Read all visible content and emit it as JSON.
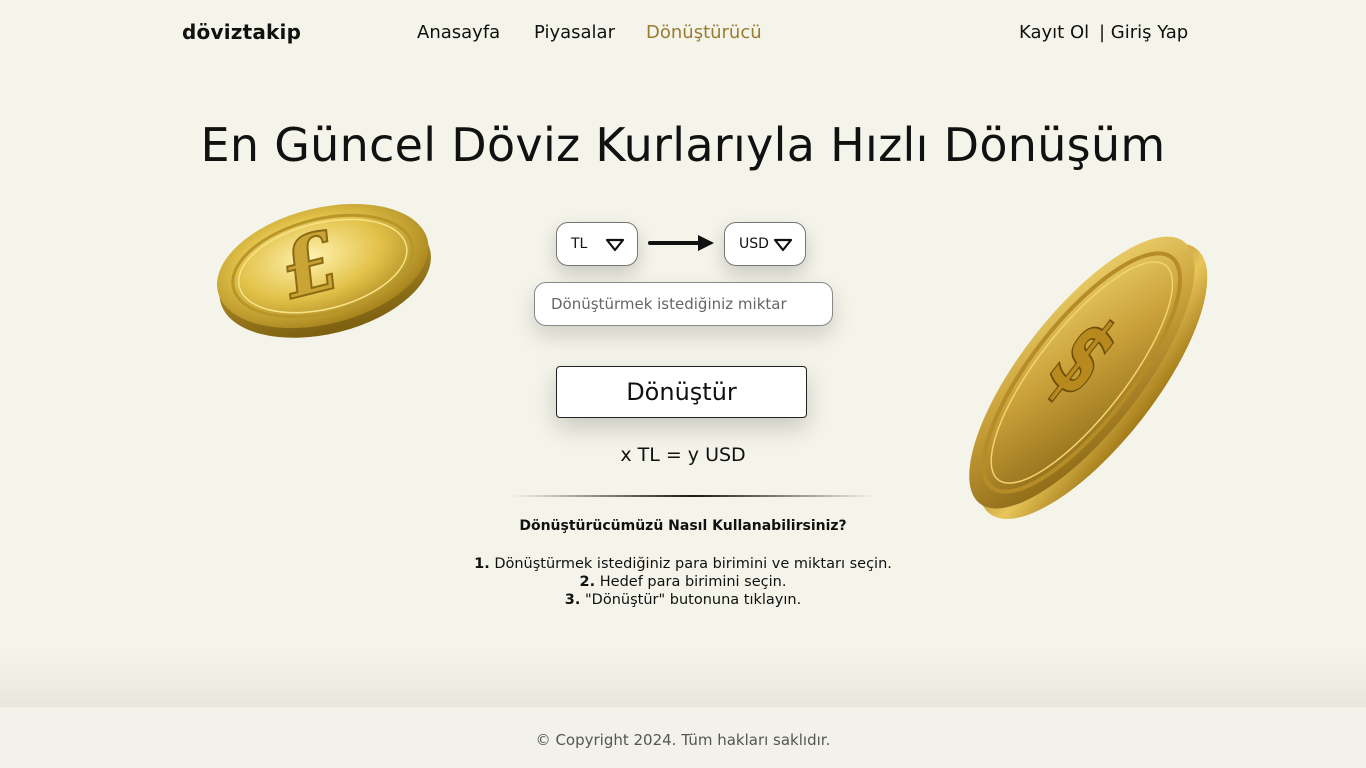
{
  "nav": {
    "logo": "döviztakip",
    "links": [
      {
        "label": "Anasayfa"
      },
      {
        "label": "Piyasalar"
      },
      {
        "label": "Dönüştürücü"
      }
    ],
    "signup": "Kayıt Ol",
    "login": "| Giriş Yap",
    "accent_color": "#9a7c30"
  },
  "hero": {
    "title": "En Güncel Döviz Kurlarıyla Hızlı Dönüşüm"
  },
  "converter": {
    "from_currency": "TL",
    "to_currency": "USD",
    "amount_placeholder": "Dönüştürmek istediğiniz miktar",
    "button_label": "Dönüştür",
    "result": "x TL = y USD"
  },
  "howto": {
    "title": "Dönüştürücümüzü Nasıl Kullanabilirsiniz?",
    "steps": [
      {
        "num": "1.",
        "text": "Dönüştürmek istediğiniz para birimini ve miktarı seçin."
      },
      {
        "num": "2.",
        "text": "Hedef para birimini seçin."
      },
      {
        "num": "3.",
        "text": "\"Dönüştür\" butonuna tıklayın."
      }
    ]
  },
  "decor": {
    "left_coin_symbol": "£",
    "right_coin_symbol": "$",
    "gold_color": "#d4af37"
  },
  "footer": {
    "copyright": "© Copyright 2024. Tüm hakları saklıdır."
  }
}
